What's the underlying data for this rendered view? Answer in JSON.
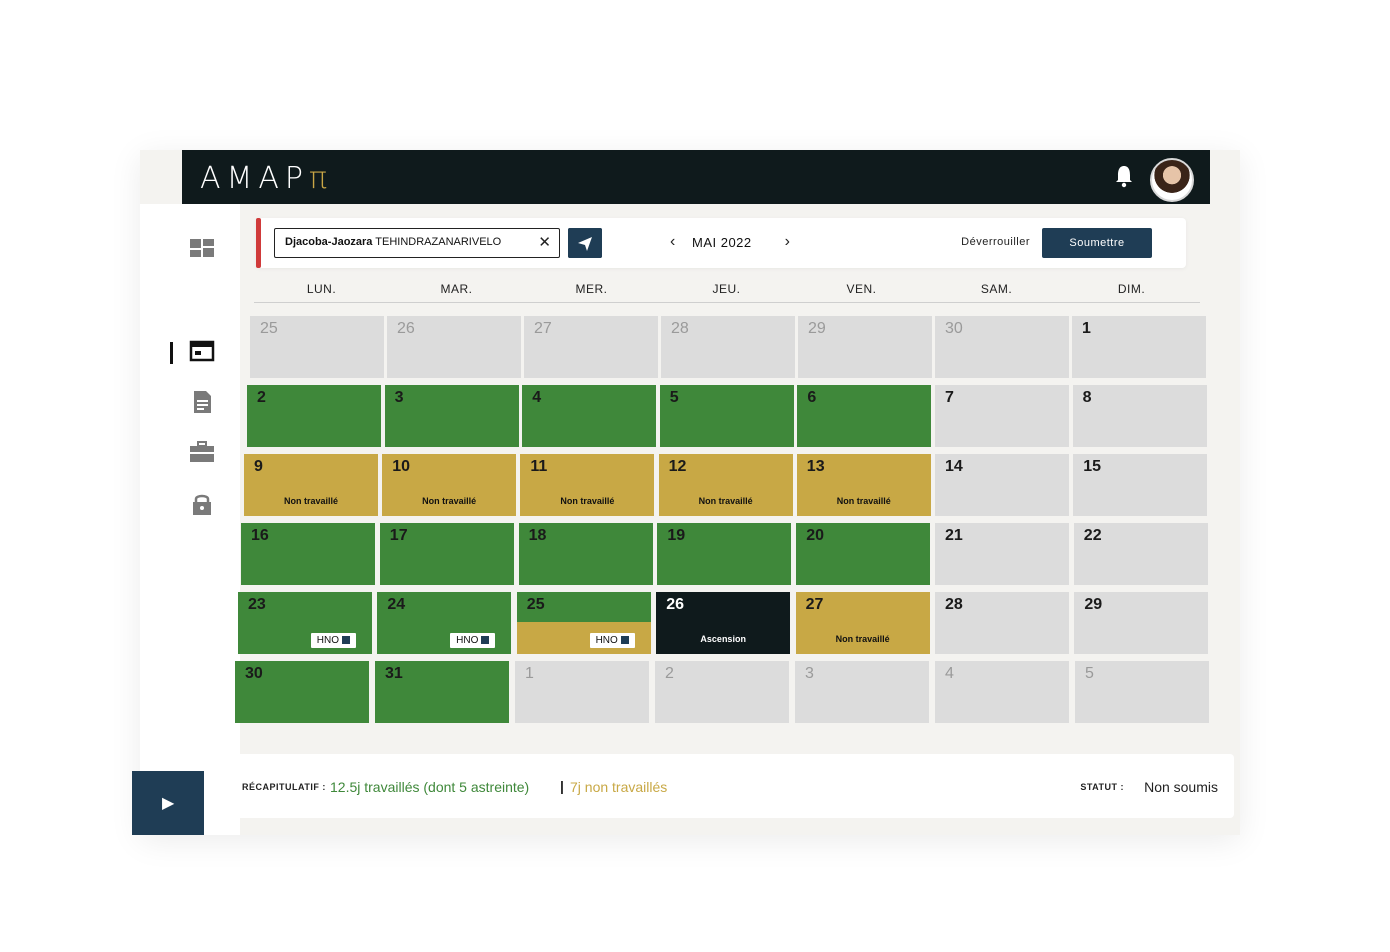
{
  "app": {
    "logo_main": "AMAP",
    "logo_accent": "π"
  },
  "toolbar": {
    "user_bold": "Djacoba-Jaozara",
    "user_rest": " TEHINDRAZANARIVELO",
    "clear": "✕",
    "month_label": "MAI 2022",
    "prev": "‹",
    "next": "›",
    "unlock_label": "Déverrouiller",
    "submit_label": "Soumettre"
  },
  "days_of_week": [
    "LUN.",
    "MAR.",
    "MER.",
    "JEU.",
    "VEN.",
    "SAM.",
    "DIM."
  ],
  "calendar": [
    [
      {
        "n": "25",
        "t": "gray",
        "o": true
      },
      {
        "n": "26",
        "t": "gray",
        "o": true
      },
      {
        "n": "27",
        "t": "gray",
        "o": true
      },
      {
        "n": "28",
        "t": "gray",
        "o": true
      },
      {
        "n": "29",
        "t": "gray",
        "o": true
      },
      {
        "n": "30",
        "t": "gray",
        "o": true
      },
      {
        "n": "1",
        "t": "gray"
      }
    ],
    [
      {
        "n": "2",
        "t": "green"
      },
      {
        "n": "3",
        "t": "green"
      },
      {
        "n": "4",
        "t": "green"
      },
      {
        "n": "5",
        "t": "green"
      },
      {
        "n": "6",
        "t": "green"
      },
      {
        "n": "7",
        "t": "gray"
      },
      {
        "n": "8",
        "t": "gray"
      }
    ],
    [
      {
        "n": "9",
        "t": "gold",
        "tag": "Non travaillé"
      },
      {
        "n": "10",
        "t": "gold",
        "tag": "Non travaillé"
      },
      {
        "n": "11",
        "t": "gold",
        "tag": "Non travaillé"
      },
      {
        "n": "12",
        "t": "gold",
        "tag": "Non travaillé"
      },
      {
        "n": "13",
        "t": "gold",
        "tag": "Non travaillé"
      },
      {
        "n": "14",
        "t": "gray"
      },
      {
        "n": "15",
        "t": "gray"
      }
    ],
    [
      {
        "n": "16",
        "t": "green"
      },
      {
        "n": "17",
        "t": "green"
      },
      {
        "n": "18",
        "t": "green"
      },
      {
        "n": "19",
        "t": "green"
      },
      {
        "n": "20",
        "t": "green"
      },
      {
        "n": "21",
        "t": "gray"
      },
      {
        "n": "22",
        "t": "gray"
      }
    ],
    [
      {
        "n": "23",
        "t": "green",
        "hno": "HNO"
      },
      {
        "n": "24",
        "t": "green",
        "hno": "HNO"
      },
      {
        "n": "25",
        "t": "green",
        "split": true,
        "hno": "HNO"
      },
      {
        "n": "26",
        "t": "dark",
        "tag": "Ascension"
      },
      {
        "n": "27",
        "t": "gold",
        "tag": "Non travaillé"
      },
      {
        "n": "28",
        "t": "gray"
      },
      {
        "n": "29",
        "t": "gray"
      }
    ],
    [
      {
        "n": "30",
        "t": "green"
      },
      {
        "n": "31",
        "t": "green"
      },
      {
        "n": "1",
        "t": "gray",
        "o": true
      },
      {
        "n": "2",
        "t": "gray",
        "o": true
      },
      {
        "n": "3",
        "t": "gray",
        "o": true
      },
      {
        "n": "4",
        "t": "gray",
        "o": true
      },
      {
        "n": "5",
        "t": "gray",
        "o": true
      }
    ]
  ],
  "summary": {
    "label": "RÉCAPITULATIF :",
    "worked": "12.5j travaillés (dont 5 astreinte)",
    "separator": "|",
    "not_worked": "7j non travaillés",
    "status_label": "STATUT :",
    "status_value": "Non soumis"
  },
  "sidebar": {
    "icons": [
      "dashboard-icon",
      "calendar-icon",
      "document-icon",
      "briefcase-icon",
      "lock-icon"
    ],
    "active": "calendar-icon"
  },
  "colors": {
    "green": "#3f883a",
    "gold": "#c8a845",
    "dark": "#0f1a1c",
    "navy": "#1f3d55",
    "gray": "#dcdcdc"
  }
}
